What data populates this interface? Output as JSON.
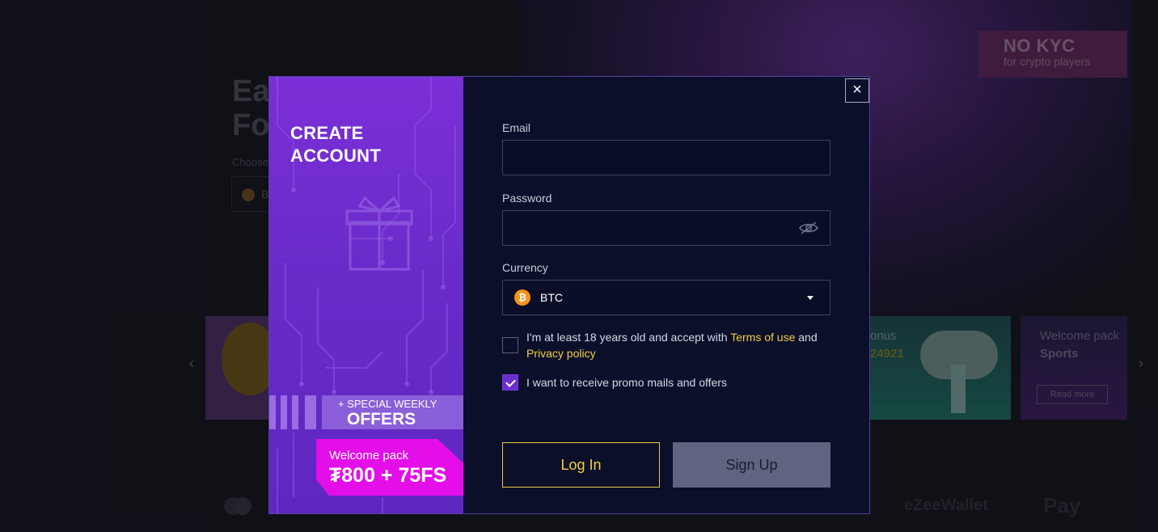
{
  "background": {
    "hero_title_line1": "Ea",
    "hero_title_line2": "Fo",
    "hero_choose": "Choose",
    "hero_currency_letter": "B",
    "kyc_badge_title": "NO KYC",
    "kyc_badge_sub": "for crypto players",
    "card_bonus_title": "onus",
    "card_bonus_code": "24921",
    "card_welcome_title": "Welcome pack",
    "card_welcome_sub": "Sports",
    "card_read_more": "Read more",
    "carousel_prev": "‹",
    "carousel_next": "›",
    "payment_ezeewallet": "eZeeWallet",
    "payment_applepay": "Pay"
  },
  "modal": {
    "title_line1": "CREATE",
    "title_line2": "ACCOUNT",
    "offers_small": "+ SPECIAL WEEKLY",
    "offers_big": "OFFERS",
    "welcome_label": "Welcome pack",
    "welcome_value": "₮800 + 75FS",
    "close_icon": "×"
  },
  "form": {
    "email_label": "Email",
    "email_value": "",
    "password_label": "Password",
    "password_value": "",
    "currency_label": "Currency",
    "currency_value": "BTC",
    "currency_icon_glyph": "₿",
    "terms_prefix": "I'm at least 18 years old and accept with",
    "terms_link": "Terms of use",
    "terms_and": "and",
    "privacy_link": "Privacy policy",
    "terms_checked": false,
    "promo_label": "I want to receive promo mails and offers",
    "promo_checked": true,
    "login_button": "Log In",
    "signup_button": "Sign Up"
  },
  "colors": {
    "accent_yellow": "#f2cf3b",
    "brand_purple": "#6a2bc9",
    "promo_magenta": "#e40ee8",
    "modal_bg": "#0b0f2a",
    "btc_orange": "#f7931a"
  }
}
